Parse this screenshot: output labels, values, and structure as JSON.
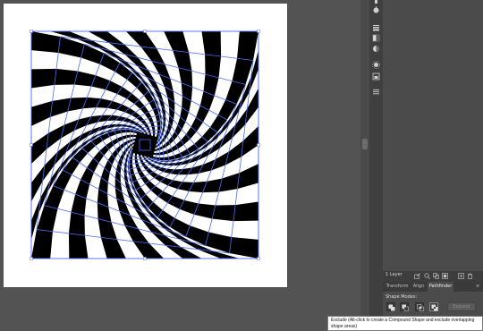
{
  "layers": {
    "count_label": "1 Layer"
  },
  "tabs": [
    {
      "label": "Transform",
      "active": false
    },
    {
      "label": "Align",
      "active": false
    },
    {
      "label": "Pathfinder",
      "active": true
    }
  ],
  "pathfinder": {
    "shape_modes_label": "Shape Modes:",
    "expand_label": "Expand",
    "modes": [
      {
        "name": "unite-icon"
      },
      {
        "name": "minus-front-icon"
      },
      {
        "name": "intersect-icon"
      },
      {
        "name": "exclude-icon"
      }
    ]
  },
  "tooltip": {
    "text": "Exclude (Alt-click to create a Compound Shape and exclude overlapping shape areas)"
  },
  "artwork": {
    "description_icon": "spiral-illusion-icon",
    "colors": {
      "dark": "#000000",
      "light": "#ffffff",
      "selection": "#4a6cf7"
    }
  },
  "strip_icons": [
    "layers-icon",
    "color-guide-icon",
    "stroke-icon",
    "gradient-icon",
    "transparency-icon",
    "appearance-icon",
    "graphic-styles-icon",
    "symbols-icon"
  ]
}
